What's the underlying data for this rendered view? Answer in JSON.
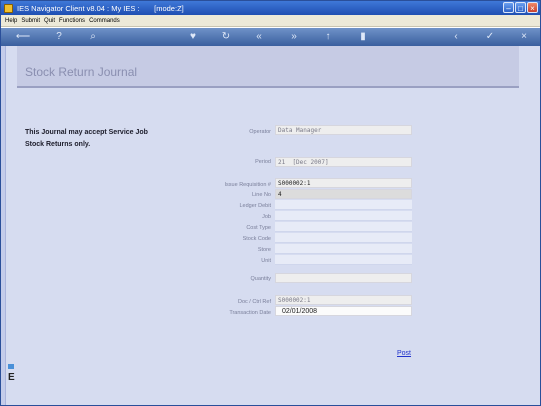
{
  "window": {
    "title": "IES Navigator Client v8.04 : My IES :       [mode:Z]"
  },
  "menu": {
    "items": [
      "Help",
      "Submit",
      "Quit",
      "Functions",
      "Commands"
    ]
  },
  "toolbar": {
    "icons": [
      "back-icon",
      "info-icon",
      "search-icon",
      "heart-icon",
      "refresh-icon",
      "first-icon",
      "last-icon",
      "up-icon",
      "stop-icon",
      "prev-icon",
      "ok-icon",
      "close-icon"
    ]
  },
  "form": {
    "title": "Stock Return Journal",
    "note": "This Journal may accept Service Job Stock Returns only.",
    "fields": {
      "operator": {
        "label": "Operator",
        "value": "Data Manager"
      },
      "period": {
        "label": "Period",
        "value": "21  [Dec 2007]"
      },
      "issue_requisition": {
        "label": "Issue Requisition #",
        "value": "S000002:1"
      },
      "line_no": {
        "label": "Line No",
        "value": "4"
      },
      "ledger_debit": {
        "label": "Ledger Debit",
        "value": ""
      },
      "job": {
        "label": "Job",
        "value": ""
      },
      "cost_type": {
        "label": "Cost Type",
        "value": ""
      },
      "stock_code": {
        "label": "Stock Code",
        "value": ""
      },
      "store": {
        "label": "Store",
        "value": ""
      },
      "unit": {
        "label": "Unit",
        "value": ""
      },
      "quantity": {
        "label": "Quantity",
        "value": ""
      },
      "doc_ref": {
        "label": "Doc / Ctrl Ref",
        "value": "S000002:1"
      },
      "transaction_date": {
        "label": "Transaction Date",
        "value": "02/01/2008"
      }
    },
    "post_label": "Post"
  },
  "colors": {
    "title_bar": "#1f4fb2",
    "content_bg": "#d6dcf0",
    "link": "#2233cc"
  }
}
